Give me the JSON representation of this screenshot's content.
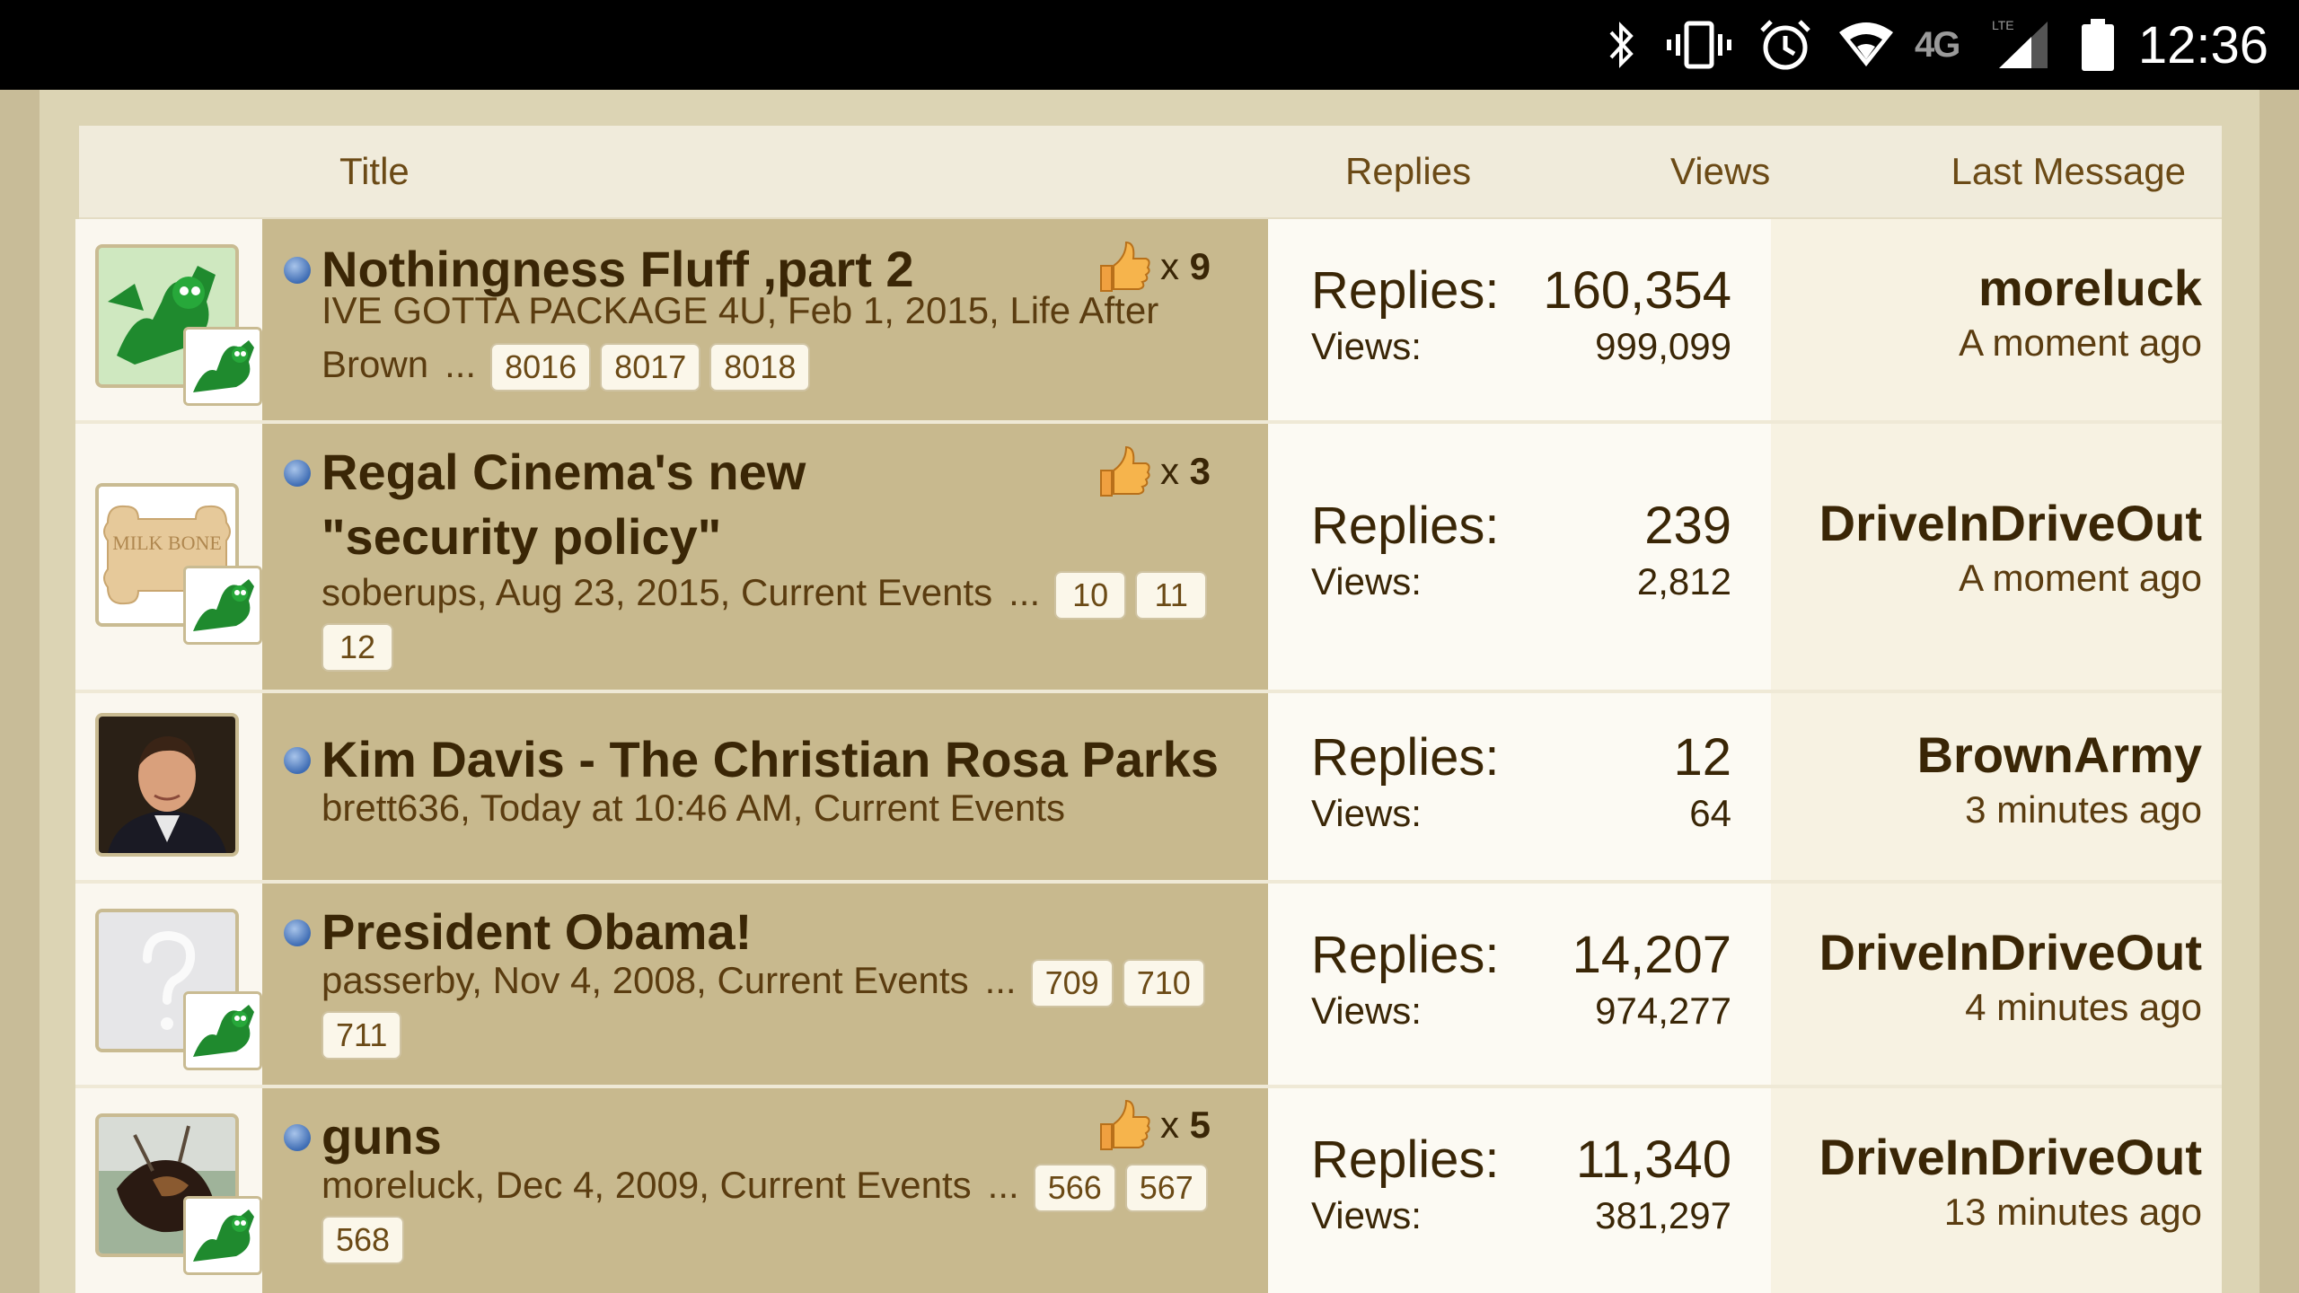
{
  "status_bar": {
    "time": "12:36",
    "network": "4G",
    "network_sub": "LTE",
    "icons": [
      "bluetooth-icon",
      "vibrate-icon",
      "alarm-icon",
      "wifi-icon",
      "signal-icon",
      "battery-icon"
    ]
  },
  "header": {
    "title": "Title",
    "replies": "Replies",
    "views": "Views",
    "last_message": "Last Message"
  },
  "labels": {
    "replies": "Replies:",
    "views": "Views:",
    "ellipsis": "..."
  },
  "threads": [
    {
      "title": "Nothingness Fluff ,part 2",
      "meta_line1": "IVE GOTTA PACKAGE 4U, Feb 1, 2015, Life After",
      "meta_line2": "Brown",
      "pages": [
        "8016",
        "8017",
        "8018"
      ],
      "likes_prefix": "x",
      "likes": "9",
      "replies": "160,354",
      "views": "999,099",
      "last_user": "moreluck",
      "last_time": "A moment ago",
      "avatar": "gumby-avatar"
    },
    {
      "title_line1": "Regal Cinema's new",
      "title_line2": "\"security policy\"",
      "meta_line1": "soberups, Aug 23, 2015, Current Events",
      "pages_inline": [
        "10",
        "11"
      ],
      "pages_wrap": [
        "12"
      ],
      "likes_prefix": "x",
      "likes": "3",
      "replies": "239",
      "views": "2,812",
      "last_user": "DriveInDriveOut",
      "last_time": "A moment ago",
      "avatar": "milk-bone-avatar",
      "avatar_text": "MILK BONE"
    },
    {
      "title": "Kim Davis - The Christian Rosa Parks",
      "meta_line1": "brett636, Today at 10:46 AM, Current Events",
      "replies": "12",
      "views": "64",
      "last_user": "BrownArmy",
      "last_time": "3 minutes ago",
      "avatar": "portrait-avatar"
    },
    {
      "title": "President Obama!",
      "meta_line1": "passerby, Nov 4, 2008, Current Events",
      "pages_inline": [
        "709",
        "710"
      ],
      "pages_wrap": [
        "711"
      ],
      "replies": "14,207",
      "views": "974,277",
      "last_user": "DriveInDriveOut",
      "last_time": "4 minutes ago",
      "avatar": "default-question-avatar"
    },
    {
      "title": "guns",
      "meta_line1": "moreluck, Dec 4, 2009, Current Events",
      "pages_inline": [
        "566",
        "567"
      ],
      "pages_wrap": [
        "568"
      ],
      "likes_prefix": "x",
      "likes": "5",
      "replies": "11,340",
      "views": "381,297",
      "last_user": "DriveInDriveOut",
      "last_time": "13 minutes ago",
      "avatar": "dog-photo-avatar"
    }
  ],
  "colors": {
    "title_text": "#3a2606",
    "header_text": "#6b4a16",
    "row_bg": "#c8b98e",
    "stats_bg": "#fcfaf3"
  }
}
